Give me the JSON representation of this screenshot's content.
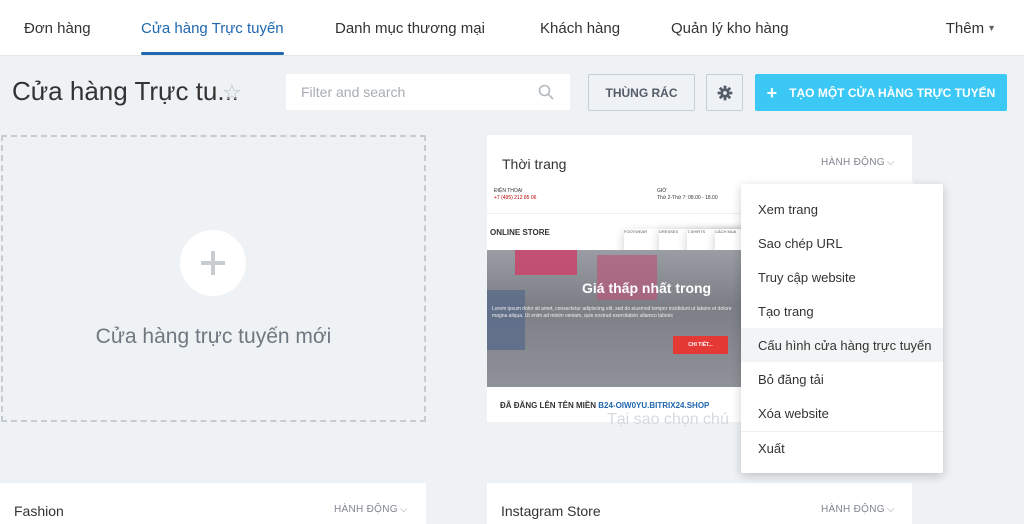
{
  "nav": {
    "tabs": [
      {
        "label": "Đơn hàng"
      },
      {
        "label": "Cửa hàng Trực tuyến"
      },
      {
        "label": "Danh mục thương mại"
      },
      {
        "label": "Khách hàng"
      },
      {
        "label": "Quản lý kho hàng"
      }
    ],
    "more_label": "Thêm"
  },
  "header": {
    "title": "Cửa hàng Trực tu...",
    "search_placeholder": "Filter and search",
    "trash_label": "THÙNG RÁC",
    "create_label": "TẠO MỘT CỬA HÀNG TRỰC TUYẾN",
    "accent_color": "#3bc8f5"
  },
  "new_store": {
    "label": "Cửa hàng trực tuyến mới"
  },
  "cards": {
    "fashion_vn": {
      "title": "Thời trang",
      "action": "HÀNH ĐỘNG",
      "preview": {
        "phone_label": "ĐIỆN THOẠI",
        "phone": "+7 (495) 212 85 06",
        "hours_label": "GIỜ",
        "hours": "Thứ 2-Thứ 7: 08.00 - 18.00",
        "logo": "ONLINE STORE",
        "menu1": "FOOTWEAR",
        "menu2": "DRESSES",
        "menu3": "T-SHIRTS",
        "menu4": "CÁCH MUA",
        "hero_text": "Giá thấp nhất trong",
        "hero_sub": "Lorem ipsum dolor sit amet, consectetur adipiscing elit, sed do eiusmod tempor incididunt ut labore et dolore magna aliqua. Ut enim ad minim veniam, quis nostrud exercitation ullamco laboris",
        "hero_button": "CHI TIẾT..."
      },
      "domain_label": "ĐÃ ĐĂNG LÊN TÊN MIỀN",
      "domain": "B24-OIW0YU.BITRIX24.SHOP",
      "faded_text": "Tại sao chọn chú"
    },
    "fashion": {
      "title": "Fashion",
      "action": "HÀNH ĐỘNG"
    },
    "instagram": {
      "title": "Instagram Store",
      "action": "HÀNH ĐỘNG"
    }
  },
  "dropdown": {
    "items": [
      {
        "label": "Xem trang"
      },
      {
        "label": "Sao chép URL"
      },
      {
        "label": "Truy cập website"
      },
      {
        "label": "Tạo trang"
      },
      {
        "label": "Cấu hình cửa hàng trực tuyến"
      },
      {
        "label": "Bỏ đăng tải"
      },
      {
        "label": "Xóa website"
      },
      {
        "label": "Xuất"
      }
    ]
  }
}
